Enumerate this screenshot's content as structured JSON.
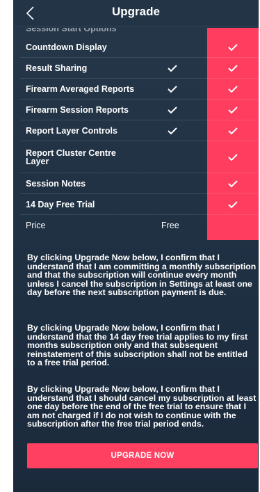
{
  "header": {
    "title": "Upgrade"
  },
  "table": {
    "cut_off_label": "Session Start Options",
    "rows": [
      {
        "label": "Countdown Display",
        "free": false,
        "premium": true
      },
      {
        "label": "Result Sharing",
        "free": true,
        "premium": true
      },
      {
        "label": "Firearm Averaged Reports",
        "free": true,
        "premium": true
      },
      {
        "label": "Firearm Session Reports",
        "free": true,
        "premium": true
      },
      {
        "label": "Report Layer Controls",
        "free": true,
        "premium": true
      },
      {
        "label": "Report Cluster Centre Layer",
        "free": false,
        "premium": true
      },
      {
        "label": "Session Notes",
        "free": false,
        "premium": true
      },
      {
        "label": "14 Day Free Trial",
        "free": false,
        "premium": true
      },
      {
        "label": "Price",
        "free_value": "Free",
        "premium_value": ""
      }
    ]
  },
  "disclaimers": [
    "By clicking Upgrade Now below, I confirm that I understand that I am committing a monthly subscription and that the subscription will continue every month unless I cancel the subscription in Settings at least one day before the next subscription payment is due.",
    "By clicking Upgrade Now below, I confirm that I understand that the 14 day free trial applies to my first months subscription only and that subsequent reinstatement of this subscription shall not be entitled to a free trial period.",
    "By clicking Upgrade Now below, I confirm that I understand that I should cancel my subscription at least one day before the end of the free trial to ensure that I am not charged if I do not wish to continue with the subscription after the free trial period ends."
  ],
  "actions": {
    "upgrade_label": "UPGRADE NOW"
  },
  "colors": {
    "accent": "#ff4060",
    "background": "#223447",
    "tick": "#ffffff"
  },
  "icons": {
    "back": "chevron-left-icon",
    "tick": "checkmark-icon"
  }
}
